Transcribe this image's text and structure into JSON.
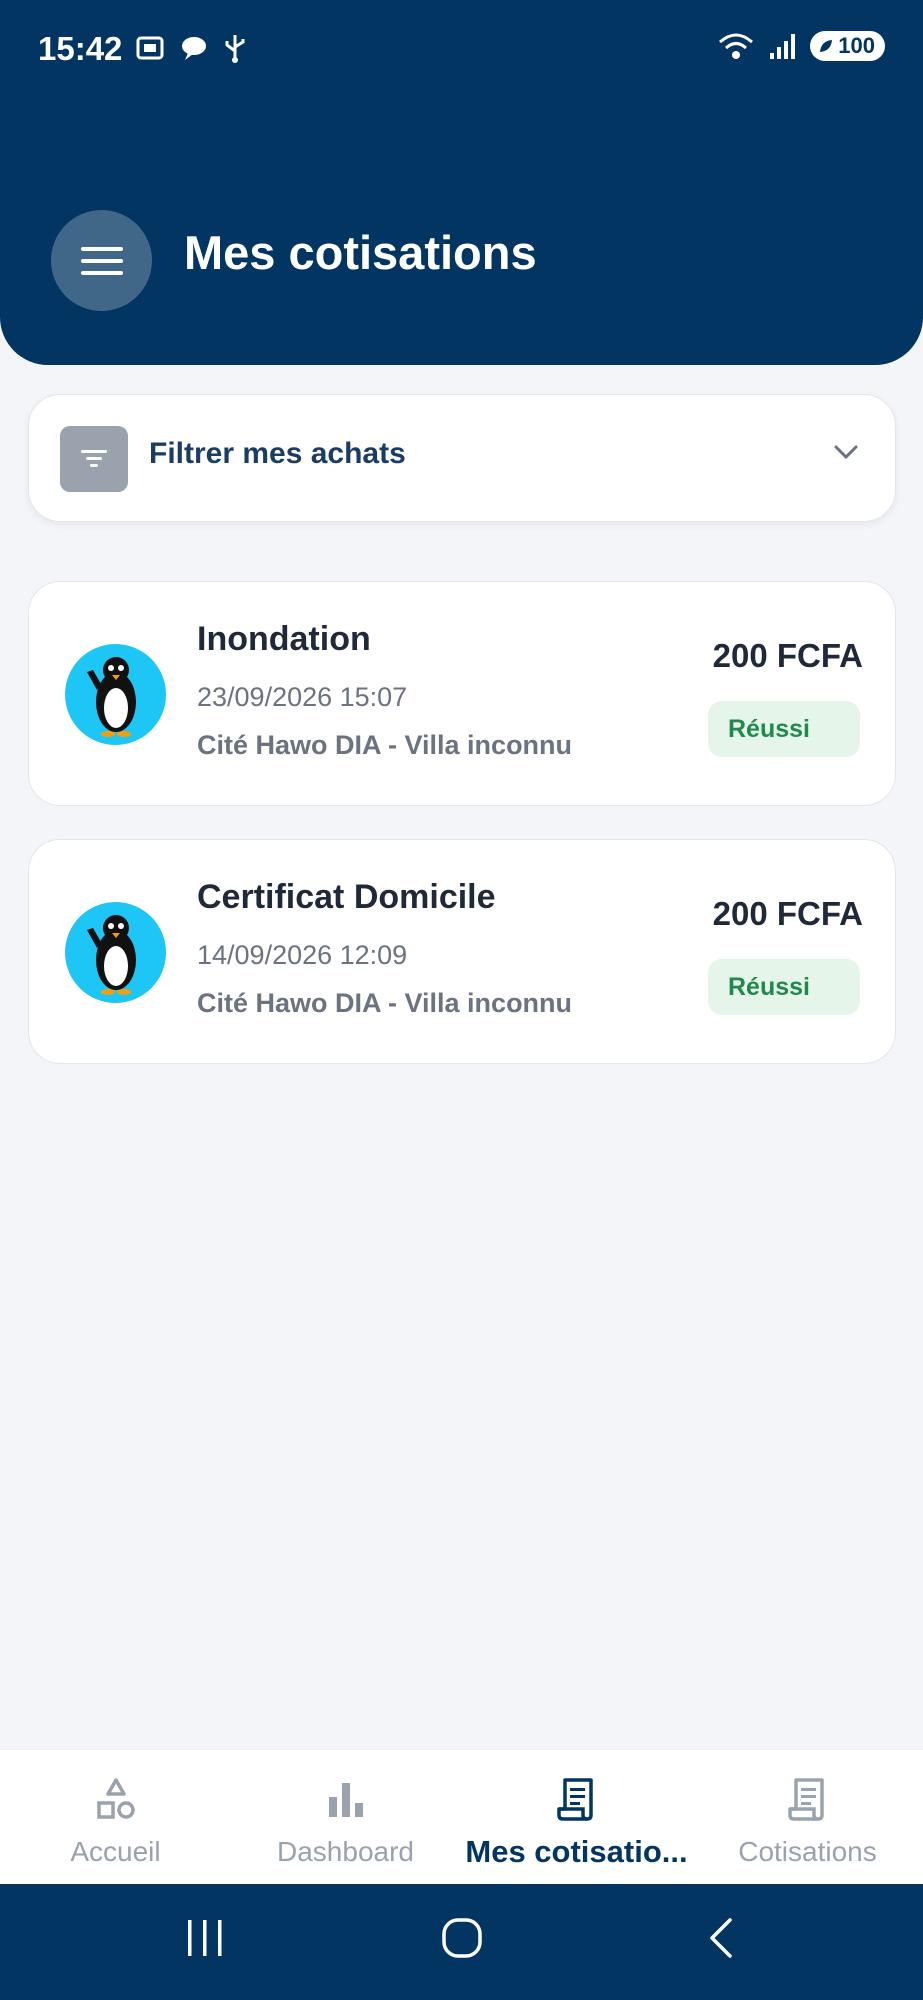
{
  "status_bar": {
    "time": "15:42",
    "battery": "100"
  },
  "header": {
    "title": "Mes cotisations"
  },
  "filter": {
    "label": "Filtrer mes achats"
  },
  "cards": [
    {
      "title": "Inondation",
      "date": "23/09/2026 15:07",
      "place": "Cité Hawo DIA - Villa inconnu",
      "amount": "200 FCFA",
      "status": "Réussi"
    },
    {
      "title": "Certificat Domicile",
      "date": "14/09/2026 12:09",
      "place": "Cité Hawo DIA - Villa inconnu",
      "amount": "200 FCFA",
      "status": "Réussi"
    }
  ],
  "tabs": [
    {
      "label": "Accueil",
      "icon": "shapes-icon"
    },
    {
      "label": "Dashboard",
      "icon": "bar-chart-icon"
    },
    {
      "label": "Mes cotisatio...",
      "icon": "receipt-icon"
    },
    {
      "label": "Cotisations",
      "icon": "receipt-icon"
    }
  ],
  "colors": {
    "primary": "#023561",
    "success_bg": "#e5f5e9",
    "success_text": "#1f8a4c",
    "avatar_bg": "#1ec6f5"
  }
}
